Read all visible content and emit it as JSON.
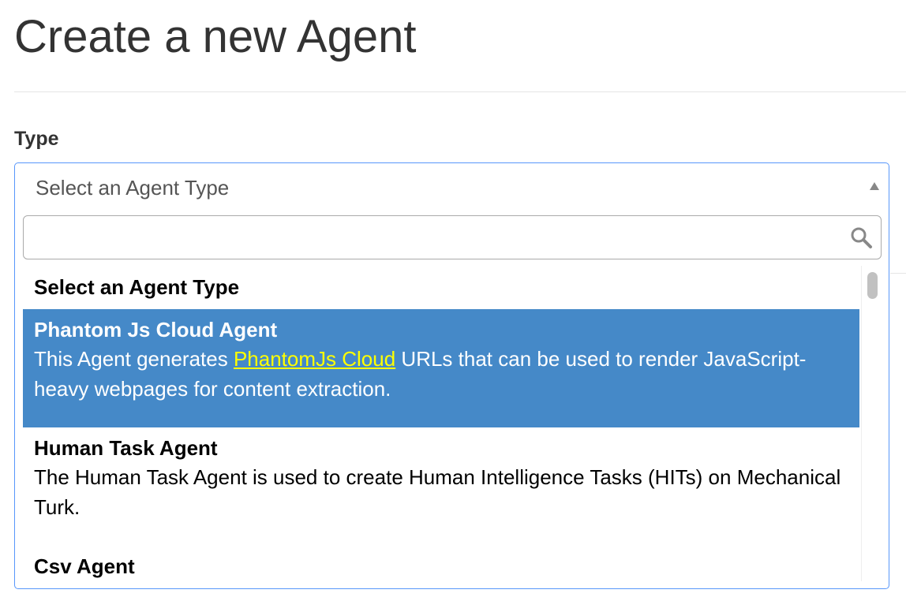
{
  "page": {
    "title": "Create a new Agent"
  },
  "form": {
    "type_label": "Type",
    "select": {
      "current": "Select an Agent Type",
      "search_placeholder": "",
      "search_value": "",
      "results": {
        "placeholder": "Select an Agent Type",
        "options": [
          {
            "title": "Phantom Js Cloud Agent",
            "desc_before": "This Agent generates ",
            "desc_link": "PhantomJs Cloud",
            "desc_after": " URLs that can be used to render JavaScript-heavy webpages for content extraction.",
            "highlighted": true
          },
          {
            "title": "Human Task Agent",
            "desc": "The Human Task Agent is used to create Human Intelligence Tasks (HITs) on Mechanical Turk.",
            "highlighted": false
          },
          {
            "title": "Csv Agent",
            "highlighted": false
          }
        ]
      }
    }
  },
  "icons": {
    "search": "search-icon",
    "dropdown_arrow": "chevron-up-icon"
  },
  "colors": {
    "highlight_bg": "#4589c8",
    "link": "#ffff00",
    "focus_border": "#5897fb"
  }
}
